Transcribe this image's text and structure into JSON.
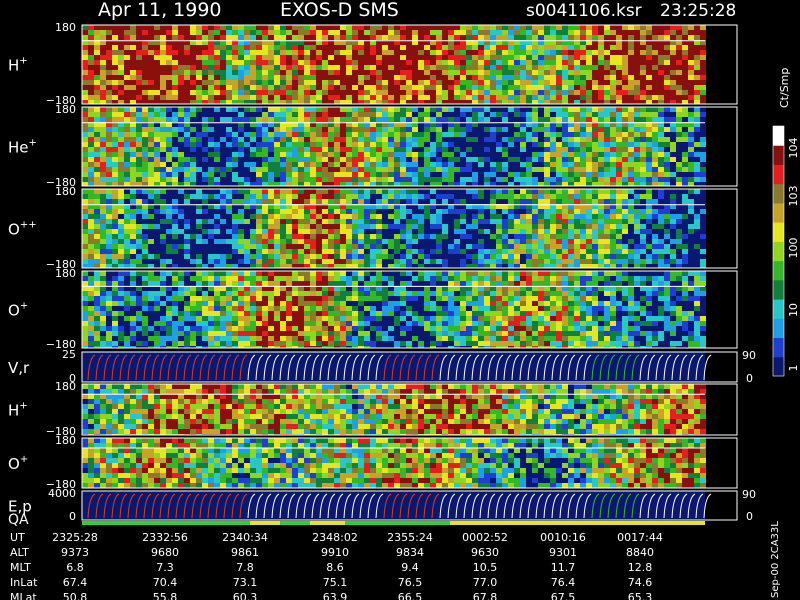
{
  "header": {
    "date": "Apr 11, 1990",
    "instrument": "EXOS-D SMS",
    "file": "s0041106.ksr",
    "time": "23:25:28"
  },
  "colorbar": {
    "unit": "Ct/Smp",
    "ticks": [
      "1",
      "10",
      "100",
      "10",
      "10",
      "3",
      "4"
    ],
    "tick_values": [
      1,
      10,
      100,
      1000,
      10000
    ],
    "colors": [
      "#0a1870",
      "#1e3fd0",
      "#1f9fe6",
      "#29c7c7",
      "#11803a",
      "#35b826",
      "#8ed61f",
      "#e6e620",
      "#c8a32a",
      "#8a7a2b",
      "#e61e1e",
      "#8a1010",
      "#ffffff"
    ]
  },
  "chart_data": {
    "type": "heatmap",
    "panels": [
      {
        "label": "H",
        "sup": "+",
        "ymax": "180",
        "ymin": "−180",
        "kind": "spectrogram",
        "level": 0.62
      },
      {
        "label": "He",
        "sup": "+",
        "ymax": "180",
        "ymin": "−180",
        "kind": "spectrogram",
        "level": 0.22
      },
      {
        "label": "O",
        "sup": "++",
        "ymax": "180",
        "ymin": "−180",
        "kind": "spectrogram",
        "level": 0.2
      },
      {
        "label": "O",
        "sup": "+",
        "ymax": "180",
        "ymin": "−180",
        "kind": "spectrogram",
        "level": 0.3
      },
      {
        "label": "V,r",
        "sup": "",
        "ymax": "25",
        "ymin": "0",
        "kind": "sweep",
        "right_top": "90",
        "right_bottom": "0"
      },
      {
        "label": "H",
        "sup": "+",
        "ymax": "180",
        "ymin": "−180",
        "kind": "spectrogram",
        "level": 0.48
      },
      {
        "label": "O",
        "sup": "+",
        "ymax": "180",
        "ymin": "−180",
        "kind": "spectrogram",
        "level": 0.35
      },
      {
        "label": "E,p",
        "sup": "",
        "ymax": "4000",
        "ymin": "0",
        "kind": "sweep",
        "right_top": "90",
        "right_bottom": "0"
      }
    ],
    "qa_label": "QA",
    "ephemeris": {
      "rows": [
        {
          "name": "UT",
          "values": [
            "2325:28",
            "2332:56",
            "2340:34",
            "2348:02",
            "2355:24",
            "0002:52",
            "0010:16",
            "0017:44"
          ]
        },
        {
          "name": "ALT",
          "values": [
            "9373",
            "9680",
            "9861",
            "9910",
            "9834",
            "9630",
            "9301",
            "8840"
          ]
        },
        {
          "name": "MLT",
          "values": [
            "6.8",
            "7.3",
            "7.8",
            "8.6",
            "9.4",
            "10.5",
            "11.7",
            "12.8"
          ]
        },
        {
          "name": "InLat",
          "values": [
            "67.4",
            "70.4",
            "73.1",
            "75.1",
            "76.5",
            "77.0",
            "76.4",
            "74.6"
          ]
        },
        {
          "name": "MLat",
          "values": [
            "50.8",
            "55.8",
            "60.3",
            "63.9",
            "66.5",
            "67.8",
            "67.5",
            "65.3"
          ]
        }
      ]
    }
  },
  "footer": {
    "vertical_note": "Sep-00 2CA33L"
  }
}
